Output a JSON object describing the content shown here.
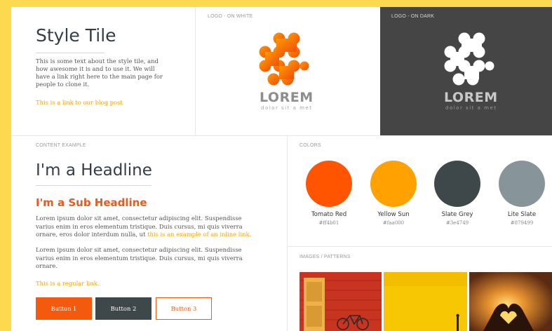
{
  "style_tile": {
    "title": "Style Tile",
    "description": "This is some text about the style tile, and how awesome it is and to use it. We will have a link right here to the main page for people to clone it.",
    "link": "This is a link to our blog post"
  },
  "logo_white": {
    "caption": "LOGO - ON WHITE",
    "word": "LOREM",
    "tagline": "dolor sit a met"
  },
  "logo_dark": {
    "caption": "LOGO - ON DARK",
    "word": "LOREM",
    "tagline": "dolor sit a met"
  },
  "content": {
    "caption": "CONTENT EXAMPLE",
    "headline": "I'm a Headline",
    "subheadline": "I'm a Sub Headline",
    "para1_before": "Lorem ipsum dolor sit amet, consectetur adipiscing elit. Suspendisse varius enim in eros elementum tristique. Duis cursus, mi quis viverra ornare, eros dolor interdum nulla, ut ",
    "para1_link": "this is an example of an inline link.",
    "para2": "Lorem ipsum dolor sit amet, consectetur adipiscing elit. Suspendisse varius enim in eros elementum tristique. Duis cursus, mi quis viverra ornare.",
    "regular_link": "This is a regular link.",
    "button1": "Button 1",
    "button2": "Button 2",
    "button3": "Button 3"
  },
  "colors": {
    "caption": "COLORS",
    "swatches": [
      {
        "name": "Tomato Red",
        "hex": "#ff4b01",
        "color": "#ff5400"
      },
      {
        "name": "Yellow Sun",
        "hex": "#faa000",
        "color": "#ffa100"
      },
      {
        "name": "Slate Grey",
        "hex": "#3e4749",
        "color": "#3e4749"
      },
      {
        "name": "Lite Slate",
        "hex": "#879499",
        "color": "#879499"
      }
    ]
  },
  "images": {
    "caption": "IMAGES / PATTERNS"
  },
  "theme": {
    "background": "#fdd94f",
    "orange": "#f45a0e",
    "yellow": "#f5a300",
    "slate": "#3e4749"
  }
}
